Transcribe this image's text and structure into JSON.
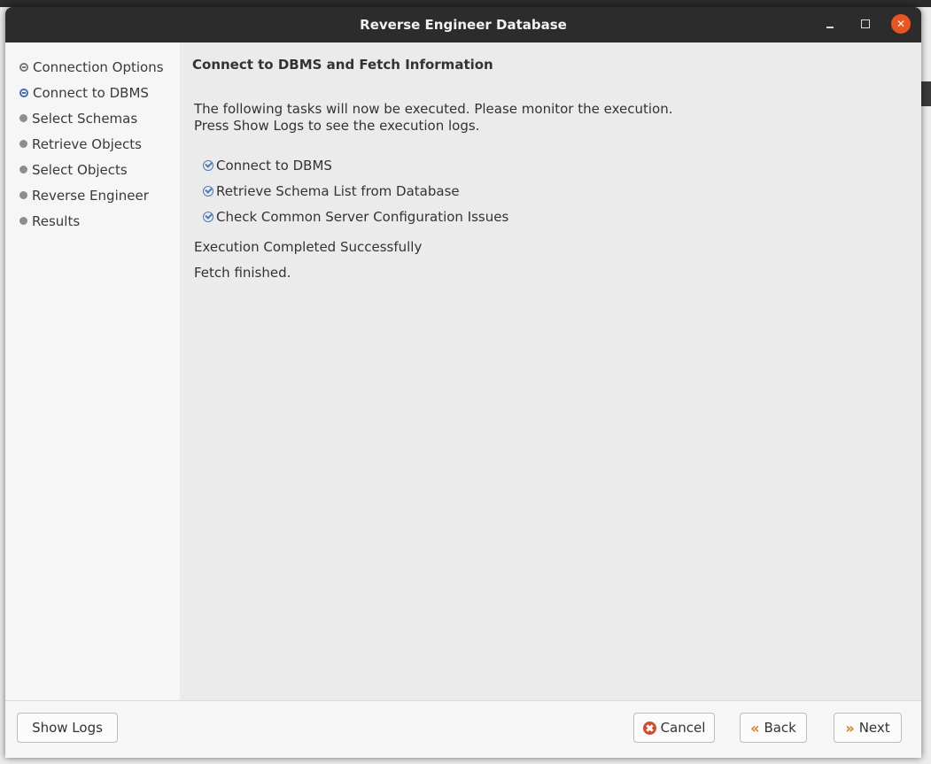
{
  "window": {
    "title": "Reverse Engineer Database",
    "controls": {
      "minimize": "minimize-icon",
      "maximize": "maximize-icon",
      "close": "close-icon"
    }
  },
  "sidebar": {
    "steps": [
      {
        "label": "Connection Options",
        "state": "done"
      },
      {
        "label": "Connect to DBMS",
        "state": "active"
      },
      {
        "label": "Select Schemas",
        "state": "pending"
      },
      {
        "label": "Retrieve Objects",
        "state": "pending"
      },
      {
        "label": "Select Objects",
        "state": "pending"
      },
      {
        "label": "Reverse Engineer",
        "state": "pending"
      },
      {
        "label": "Results",
        "state": "pending"
      }
    ]
  },
  "main": {
    "title": "Connect to DBMS and Fetch Information",
    "intro_line1": "The following tasks will now be executed. Please monitor the execution.",
    "intro_line2": "Press Show Logs to see the execution logs.",
    "tasks": [
      {
        "label": "Connect to DBMS",
        "status": "completed"
      },
      {
        "label": "Retrieve Schema List from Database",
        "status": "completed"
      },
      {
        "label": "Check Common Server Configuration Issues",
        "status": "completed"
      }
    ],
    "status_message": "Execution Completed Successfully",
    "fetch_message": "Fetch finished."
  },
  "footer": {
    "show_logs": "Show Logs",
    "cancel": "Cancel",
    "back": "Back",
    "next": "Next"
  },
  "colors": {
    "titlebar": "#2c2c2c",
    "close_button": "#e95420",
    "active_step": "#3f6fb3",
    "cancel_icon": "#d8482a",
    "chevron": "#e0781f"
  }
}
